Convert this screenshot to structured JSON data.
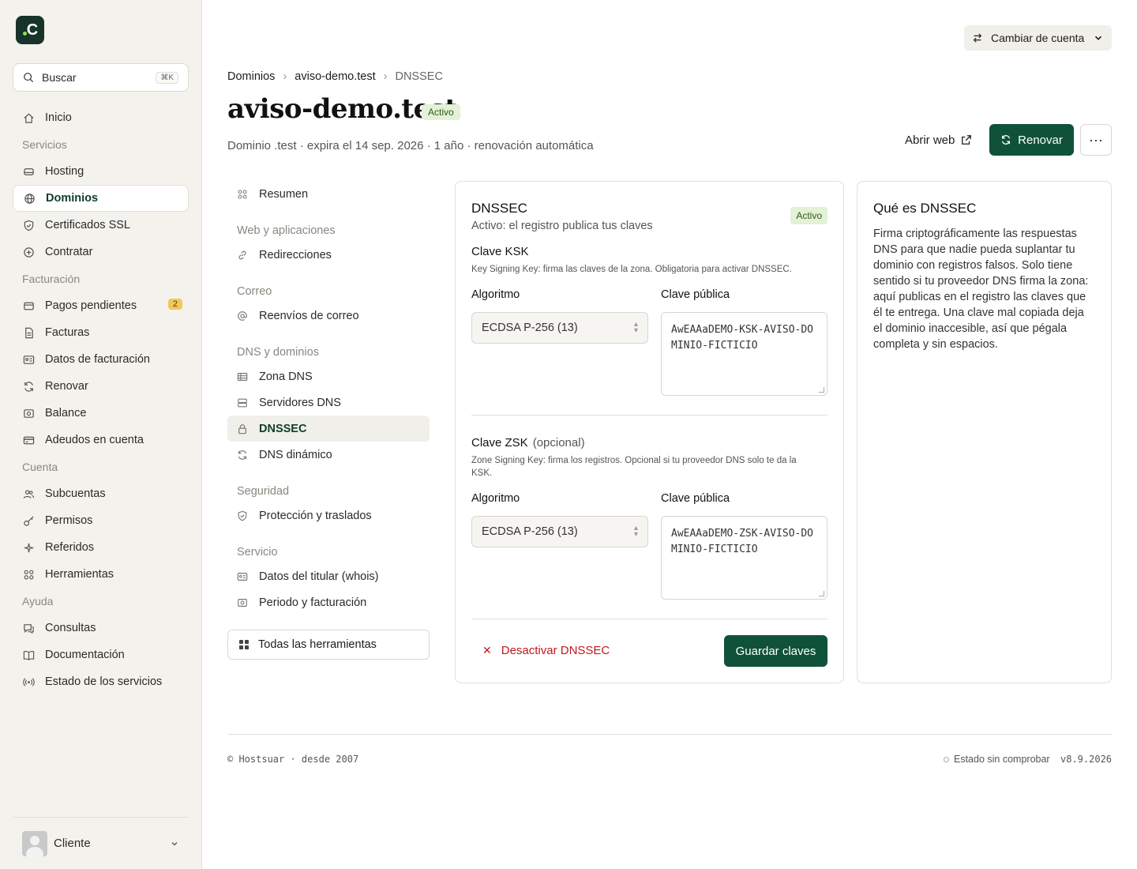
{
  "app": {
    "logo_letter": "C",
    "search_placeholder": "Buscar",
    "search_shortcut": "⌘K",
    "account_switch": "Cambiar de cuenta",
    "user_name": "Cliente"
  },
  "sidebar": {
    "items": [
      {
        "type": "item",
        "label": "Inicio",
        "icon": "home-icon"
      },
      {
        "type": "section",
        "label": "Servicios"
      },
      {
        "type": "item",
        "label": "Hosting",
        "icon": "hosting-icon"
      },
      {
        "type": "item",
        "label": "Dominios",
        "icon": "globe-icon",
        "active": true
      },
      {
        "type": "item",
        "label": "Certificados SSL",
        "icon": "shield-icon"
      },
      {
        "type": "item",
        "label": "Contratar",
        "icon": "plus-circle-icon"
      },
      {
        "type": "section",
        "label": "Facturación"
      },
      {
        "type": "item",
        "label": "Pagos pendientes",
        "icon": "wallet-icon",
        "badge": "2"
      },
      {
        "type": "item",
        "label": "Facturas",
        "icon": "file-icon"
      },
      {
        "type": "item",
        "label": "Datos de facturación",
        "icon": "id-card-icon"
      },
      {
        "type": "item",
        "label": "Renovar",
        "icon": "refresh-icon"
      },
      {
        "type": "item",
        "label": "Balance",
        "icon": "balance-icon"
      },
      {
        "type": "item",
        "label": "Adeudos en cuenta",
        "icon": "credit-card-icon"
      },
      {
        "type": "section",
        "label": "Cuenta"
      },
      {
        "type": "item",
        "label": "Subcuentas",
        "icon": "users-icon"
      },
      {
        "type": "item",
        "label": "Permisos",
        "icon": "key-icon"
      },
      {
        "type": "item",
        "label": "Referidos",
        "icon": "sparkle-icon"
      },
      {
        "type": "item",
        "label": "Herramientas",
        "icon": "grid-icon"
      },
      {
        "type": "section",
        "label": "Ayuda"
      },
      {
        "type": "item",
        "label": "Consultas",
        "icon": "chat-icon"
      },
      {
        "type": "item",
        "label": "Documentación",
        "icon": "book-icon"
      },
      {
        "type": "item",
        "label": "Estado de los servicios",
        "icon": "broadcast-icon"
      }
    ]
  },
  "breadcrumb": [
    "Dominios",
    "aviso-demo.test",
    "DNSSEC"
  ],
  "header": {
    "title": "aviso-demo.test",
    "status": "Activo",
    "subtitle": "Dominio .test · expira el 14 sep. 2026 · 1 año · renovación automática",
    "open_web": "Abrir web",
    "renew": "Renovar",
    "more": "···"
  },
  "subnav": {
    "items": [
      {
        "type": "item",
        "label": "Resumen",
        "icon": "grid-icon"
      },
      {
        "type": "section",
        "label": "Web y aplicaciones"
      },
      {
        "type": "item",
        "label": "Redirecciones",
        "icon": "link-icon"
      },
      {
        "type": "section",
        "label": "Correo"
      },
      {
        "type": "item",
        "label": "Reenvíos de correo",
        "icon": "at-icon"
      },
      {
        "type": "section",
        "label": "DNS y dominios"
      },
      {
        "type": "item",
        "label": "Zona DNS",
        "icon": "table-icon"
      },
      {
        "type": "item",
        "label": "Servidores DNS",
        "icon": "server-icon"
      },
      {
        "type": "item",
        "label": "DNSSEC",
        "icon": "lock-icon",
        "active": true
      },
      {
        "type": "item",
        "label": "DNS dinámico",
        "icon": "refresh-icon"
      },
      {
        "type": "section",
        "label": "Seguridad"
      },
      {
        "type": "item",
        "label": "Protección y traslados",
        "icon": "shield-icon"
      },
      {
        "type": "section",
        "label": "Servicio"
      },
      {
        "type": "item",
        "label": "Datos del titular (whois)",
        "icon": "id-card-icon"
      },
      {
        "type": "item",
        "label": "Periodo y facturación",
        "icon": "balance-icon"
      }
    ],
    "all_tools": "Todas las herramientas"
  },
  "dnssec": {
    "title": "DNSSEC",
    "subtitle": "Activo: el registro publica tus claves",
    "status": "Activo",
    "ksk": {
      "title": "Clave KSK",
      "desc": "Key Signing Key: firma las claves de la zona. Obligatoria para activar DNSSEC.",
      "algo_label": "Algoritmo",
      "algo_value": "ECDSA P-256 (13)",
      "key_label": "Clave pública",
      "key_value": "AwEAAaDEMO-KSK-AVISO-DOMINIO-FICTICIO"
    },
    "zsk": {
      "title": "Clave ZSK",
      "optional": "(opcional)",
      "desc": "Zone Signing Key: firma los registros. Opcional si tu proveedor DNS solo te da la KSK.",
      "algo_label": "Algoritmo",
      "algo_value": "ECDSA P-256 (13)",
      "key_label": "Clave pública",
      "key_value": "AwEAAaDEMO-ZSK-AVISO-DOMINIO-FICTICIO"
    },
    "deactivate": "Desactivar DNSSEC",
    "save": "Guardar claves"
  },
  "info": {
    "title": "Qué es DNSSEC",
    "body": "Firma criptográficamente las respuestas DNS para que nadie pueda suplantar tu dominio con registros falsos. Solo tiene sentido si tu proveedor DNS firma la zona: aquí publicas en el registro las claves que él te entrega. Una clave mal copiada deja el dominio inaccesible, así que pégala completa y sin espacios."
  },
  "footer": {
    "copyright": "© Hostsuar · desde 2007",
    "status": "Estado sin comprobar",
    "version": "v8.9.2026"
  },
  "colors": {
    "brand": "#0f5239",
    "danger": "#c0191f",
    "sidebar_bg": "#f4f2ec"
  }
}
